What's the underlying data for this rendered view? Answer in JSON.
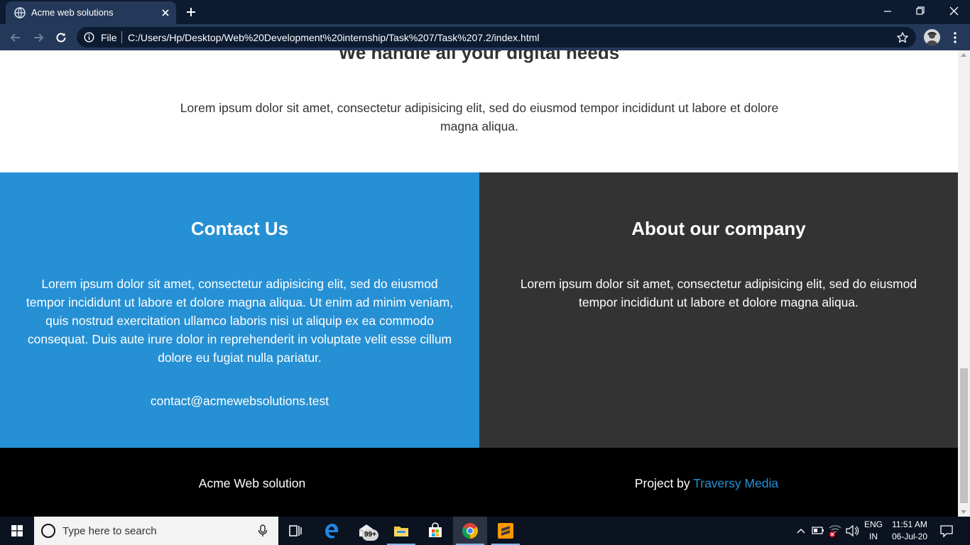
{
  "browser": {
    "tab_title": "Acme web solutions",
    "scheme_label": "File",
    "url": "C:/Users/Hp/Desktop/Web%20Development%20internship/Task%207/Task%207.2/index.html"
  },
  "page": {
    "showcase_heading": "We handle all your digital needs",
    "showcase_text": "Lorem ipsum dolor sit amet, consectetur adipisicing elit, sed do eiusmod tempor incididunt ut labore et dolore magna aliqua.",
    "contact": {
      "title": "Contact Us",
      "text": "Lorem ipsum dolor sit amet, consectetur adipisicing elit, sed do eiusmod tempor incididunt ut labore et dolore magna aliqua. Ut enim ad minim veniam, quis nostrud exercitation ullamco laboris nisi ut aliquip ex ea commodo consequat. Duis aute irure dolor in reprehenderit in voluptate velit esse cillum dolore eu fugiat nulla pariatur.",
      "email": "contact@acmewebsolutions.test"
    },
    "about": {
      "title": "About our company",
      "text": "Lorem ipsum dolor sit amet, consectetur adipisicing elit, sed do eiusmod tempor incididunt ut labore et dolore magna aliqua."
    },
    "footer": {
      "brand": "Acme Web solution",
      "credit_prefix": "Project by",
      "credit_link": "Traversy Media"
    }
  },
  "taskbar": {
    "search_placeholder": "Type here to search",
    "mail_badge": "99+",
    "lang_top": "ENG",
    "lang_bottom": "IN",
    "time": "11:51 AM",
    "date": "06-Jul-20"
  },
  "colors": {
    "contact_bg": "#2690d4",
    "about_bg": "#333333",
    "footer_bg": "#000000",
    "link": "#2690d4",
    "chrome_dark": "#0d1b31",
    "chrome_toolbar": "#24395a"
  },
  "icons": {
    "tab": "globe-icon",
    "close_tab": "close-icon",
    "new_tab": "plus-icon",
    "back": "arrow-left-icon",
    "forward": "arrow-right-icon",
    "reload": "reload-icon",
    "site_info": "info-icon",
    "bookmark": "star-icon",
    "menu": "kebab-menu-icon",
    "start": "windows-logo-icon",
    "search": "search-ring-icon",
    "mic": "microphone-icon",
    "task_view": "task-view-icon",
    "edge": "edge-icon",
    "mail": "mail-icon",
    "explorer": "folder-icon",
    "store": "store-icon",
    "chrome": "chrome-icon",
    "sublime": "sublime-text-icon",
    "tray_expand": "chevron-up-icon",
    "battery": "battery-icon",
    "network": "wifi-off-icon",
    "volume": "speaker-icon",
    "notifications": "notification-icon"
  }
}
